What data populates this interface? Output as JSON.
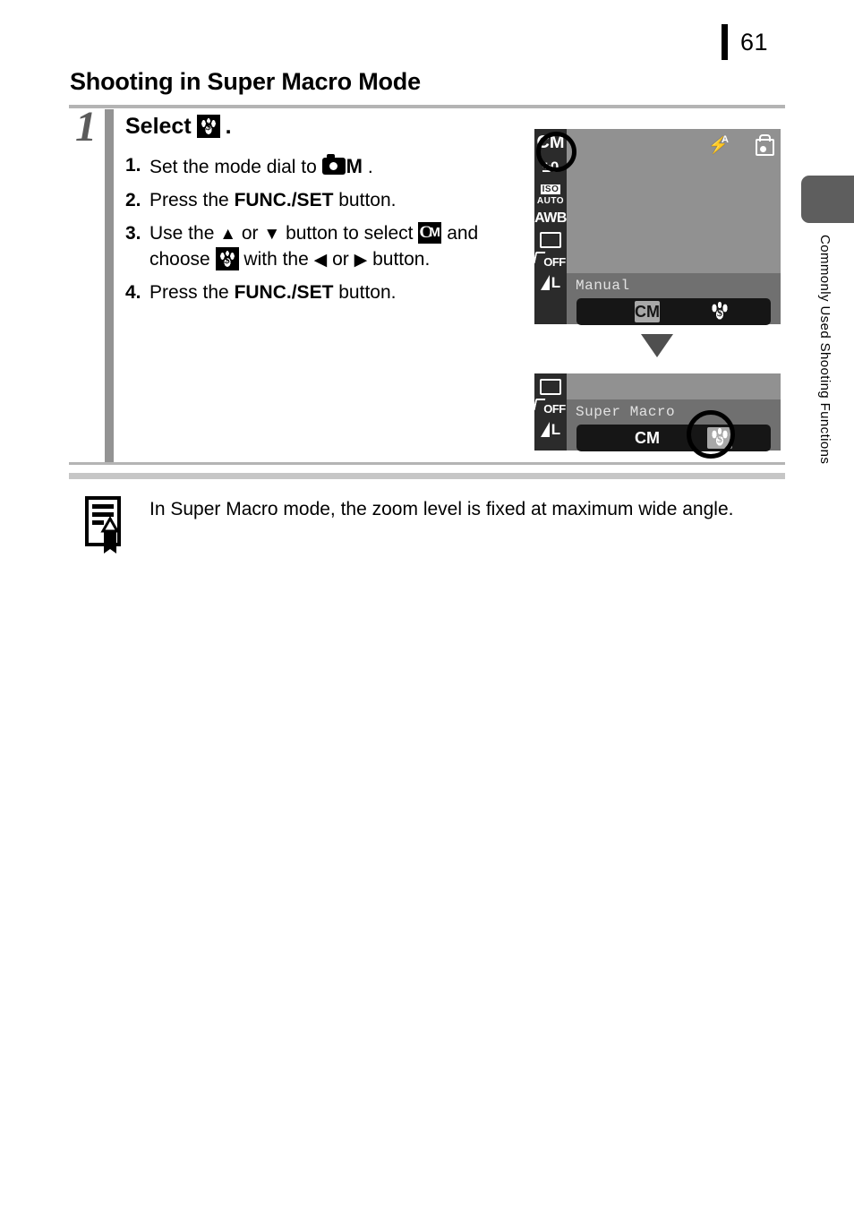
{
  "page": {
    "number": "61",
    "side_tab_label": "Commonly Used Shooting Functions"
  },
  "section": {
    "heading": "Shooting in Super Macro Mode"
  },
  "step": {
    "number": "1",
    "title_prefix": "Select",
    "title_suffix": ".",
    "title_icon": "super-macro-icon",
    "substeps": [
      {
        "num": "1.",
        "text_before": "Set the mode dial to",
        "icon": "camera-manual-icon",
        "icon_label": "M",
        "text_after": "."
      },
      {
        "num": "2.",
        "text_before": "Press the",
        "bold": "FUNC./SET",
        "text_after": "button."
      },
      {
        "num": "3.",
        "text_a": "Use the",
        "up_arrow": "▲",
        "text_b": "or",
        "down_arrow": "▼",
        "text_c": "button to select",
        "icon_cm": "cm-mode-icon",
        "text_d": "and choose",
        "icon_macro": "super-macro-icon",
        "text_e": "with the",
        "left_arrow": "◀",
        "text_f": "or",
        "right_arrow": "▶",
        "text_g": "button."
      },
      {
        "num": "4.",
        "text_before": "Press the",
        "bold": "FUNC./SET",
        "text_after": "button."
      }
    ]
  },
  "lcd_screen_1": {
    "sidebar_icons": [
      "cm-mode-icon",
      "exposure-compensation-icon",
      "iso-auto-icon",
      "awb-white-balance-icon",
      "drive-mode-icon",
      "flash-off-icon",
      "image-quality-large-icon"
    ],
    "exposure_value": "±0",
    "iso_line1": "ISO",
    "iso_line2": "AUTO",
    "white_balance": "AWB",
    "flash_off": "OFF",
    "quality": "L",
    "top_icons": [
      "flash-auto-icon",
      "camera-shake-icon"
    ],
    "flash_auto_letter": "A",
    "menu_label": "Manual",
    "options": [
      {
        "label": "CM",
        "type": "cm",
        "selected": true
      },
      {
        "label": "",
        "type": "macro",
        "selected": false
      }
    ],
    "highlight": "cm-mode-icon"
  },
  "lcd_screen_2": {
    "sidebar_icons": [
      "drive-mode-icon",
      "flash-off-icon",
      "image-quality-large-icon"
    ],
    "flash_off": "OFF",
    "quality": "L",
    "menu_label": "Super Macro",
    "options": [
      {
        "label": "CM",
        "type": "cm",
        "selected": false
      },
      {
        "label": "",
        "type": "macro",
        "selected": true
      }
    ],
    "highlight": "super-macro-icon"
  },
  "transition_arrow": "down-triangle",
  "note": {
    "icon": "memo-note-icon",
    "text": "In Super Macro mode, the zoom level is fixed at maximum wide angle."
  }
}
